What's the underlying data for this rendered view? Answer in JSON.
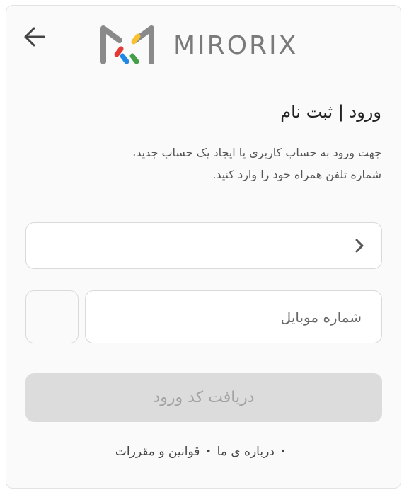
{
  "header": {
    "back_icon": "arrow-left-icon",
    "brand_name": "MIRORIX",
    "brand_colors": [
      "#e53935",
      "#fbc02d",
      "#1e88e5",
      "#43a047"
    ]
  },
  "auth": {
    "title": "ورود | ثبت نام",
    "description_line1": "جهت ورود به حساب کاربری یا ایجاد یک حساب جدید،",
    "description_line2": "شماره تلفن همراه خود را وارد کنید.",
    "country_select_icon": "chevron-right-icon",
    "phone_placeholder": "شماره موبایل",
    "phone_value": "",
    "submit_label": "دریافت کد ورود"
  },
  "footer": {
    "links": [
      "درباره ی ما",
      "قوانین و مقررات"
    ]
  }
}
